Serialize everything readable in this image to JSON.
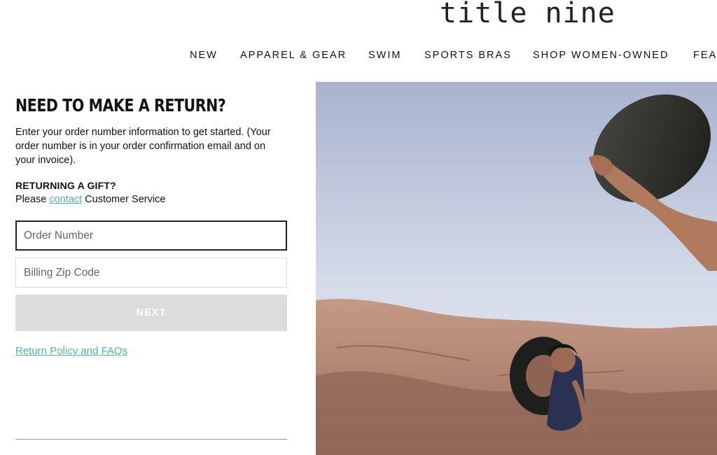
{
  "brand": {
    "logo_text": "title nine"
  },
  "nav": {
    "items": [
      {
        "label": "NEW"
      },
      {
        "label": "APPAREL & GEAR"
      },
      {
        "label": "SWIM"
      },
      {
        "label": "SPORTS BRAS"
      },
      {
        "label": "SHOP WOMEN-OWNED"
      },
      {
        "label": "FEA"
      }
    ]
  },
  "returns": {
    "heading": "NEED TO MAKE A RETURN?",
    "intro": "Enter your order number information to get started. (Your order number is in your order confirmation email and on your invoice).",
    "gift_title": "RETURNING A GIFT?",
    "gift_prefix": "Please",
    "gift_link": "contact",
    "gift_suffix": "Customer Service",
    "order_placeholder": "Order Number",
    "zip_placeholder": "Billing Zip Code",
    "next_label": "NEXT",
    "policy_link": "Return Policy and FAQs"
  },
  "colors": {
    "link": "#52b3a6",
    "button_disabled": "#dcdcdc",
    "text": "#111111"
  },
  "hero": {
    "image_description_icon": "hero-photo",
    "alt": ""
  }
}
